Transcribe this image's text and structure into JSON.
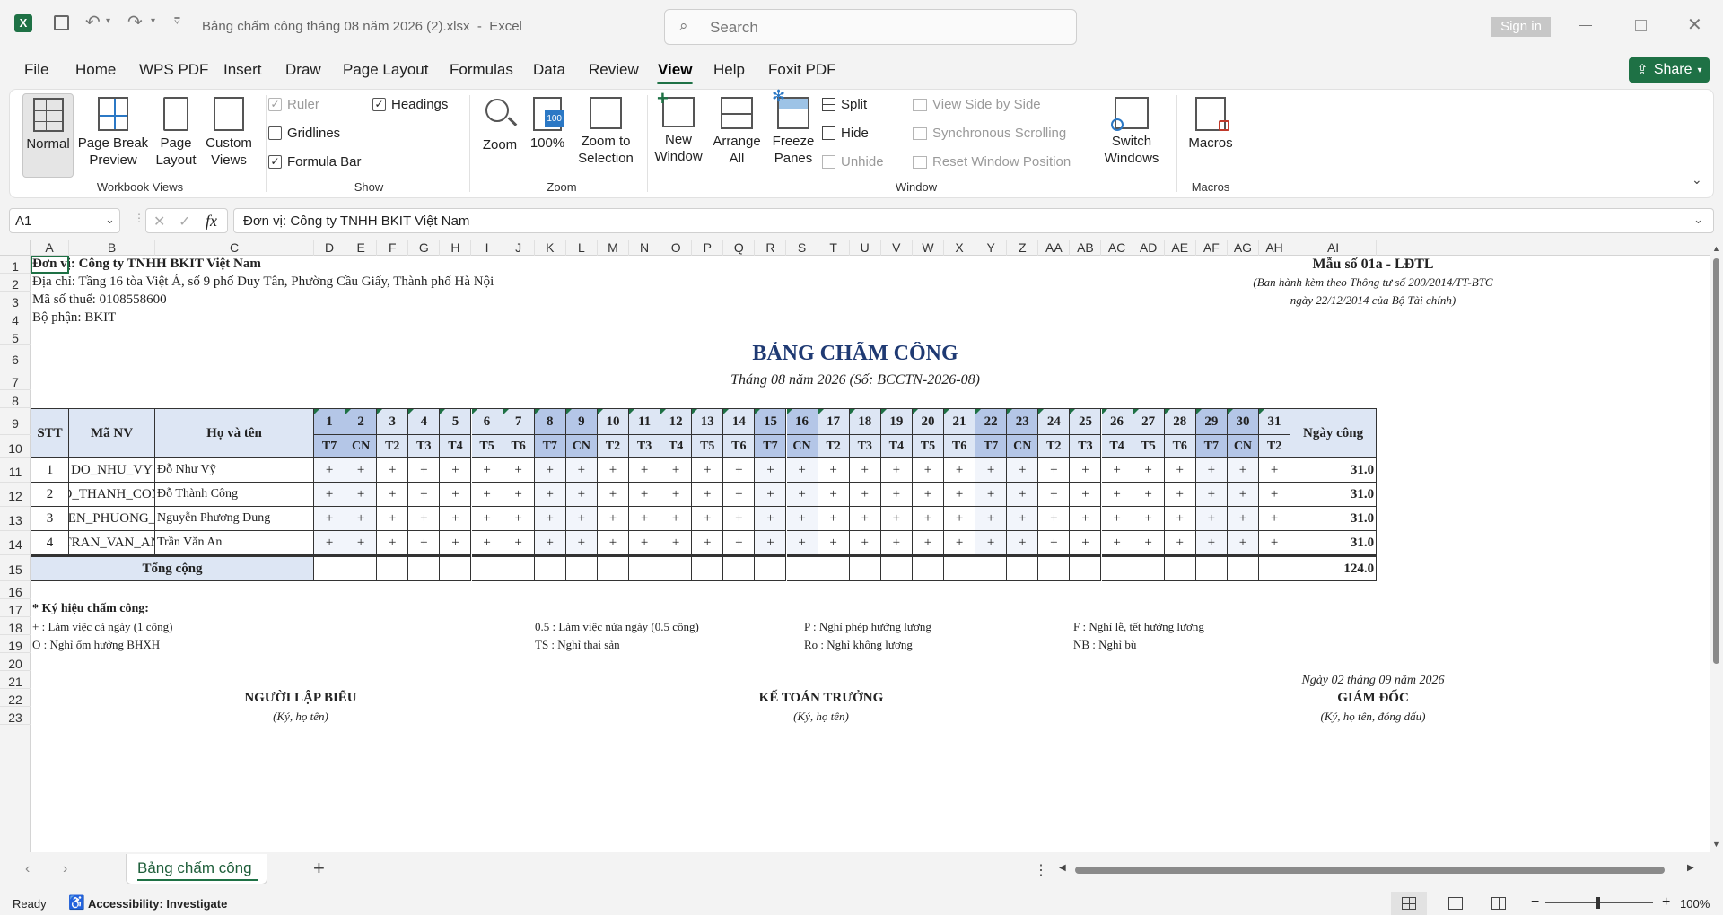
{
  "titlebar": {
    "filename": "Bảng chấm công tháng 08 năm 2026 (2).xlsx",
    "app": "Excel",
    "search_placeholder": "Search",
    "signin": "Sign in"
  },
  "menu": [
    "File",
    "Home",
    "WPS PDF",
    "Insert",
    "Draw",
    "Page Layout",
    "Formulas",
    "Data",
    "Review",
    "View",
    "Help",
    "Foxit PDF"
  ],
  "share": "Share",
  "ribbon": {
    "workbook_views": {
      "label": "Workbook Views",
      "normal": "Normal",
      "page_break": "Page Break Preview",
      "page_layout": "Page Layout",
      "custom": "Custom Views"
    },
    "show": {
      "label": "Show",
      "ruler": "Ruler",
      "gridlines": "Gridlines",
      "formula_bar": "Formula Bar",
      "headings": "Headings"
    },
    "zoom": {
      "label": "Zoom",
      "zoom": "Zoom",
      "hundred": "100%",
      "zoom_sel": "Zoom to Selection"
    },
    "window": {
      "label": "Window",
      "new_window": "New Window",
      "arrange": "Arrange All",
      "freeze": "Freeze Panes",
      "split": "Split",
      "hide": "Hide",
      "unhide": "Unhide",
      "side": "View Side by Side",
      "sync": "Synchronous Scrolling",
      "reset": "Reset Window Position",
      "switch": "Switch Windows"
    },
    "macros": {
      "label": "Macros",
      "macros": "Macros"
    }
  },
  "formula": {
    "namebox": "A1",
    "fx": "fx",
    "value": "Đơn vị: Công ty TNHH BKIT Việt Nam"
  },
  "columns": [
    "A",
    "B",
    "C",
    "D",
    "E",
    "F",
    "G",
    "H",
    "I",
    "J",
    "K",
    "L",
    "M",
    "N",
    "O",
    "P",
    "Q",
    "R",
    "S",
    "T",
    "U",
    "V",
    "W",
    "X",
    "Y",
    "Z",
    "AA",
    "AB",
    "AC",
    "AD",
    "AE",
    "AF",
    "AG",
    "AH",
    "AI"
  ],
  "rows": [
    "1",
    "2",
    "3",
    "4",
    "5",
    "6",
    "7",
    "8",
    "9",
    "10",
    "11",
    "12",
    "13",
    "14",
    "15",
    "16",
    "17",
    "18",
    "19",
    "20",
    "21",
    "22",
    "23"
  ],
  "doc": {
    "unit": "Đơn vị: Công ty TNHH BKIT Việt Nam",
    "address": "Địa chỉ: Tầng 16 tòa Việt Á, số 9 phố Duy Tân, Phường Cầu Giấy, Thành phố Hà Nội",
    "tax": "Mã số thuế: 0108558600",
    "dept": "Bộ phận: BKIT",
    "form": "Mẫu số 01a - LĐTL",
    "form_note1": "(Ban hành kèm theo Thông tư số 200/2014/TT-BTC",
    "form_note2": "ngày 22/12/2014 của Bộ Tài chính)",
    "title": "BẢNG CHẤM CÔNG",
    "subtitle": "Tháng 08 năm 2026 (Số: BCCTN-2026-08)"
  },
  "table": {
    "h_stt": "STT",
    "h_ma": "Mã NV",
    "h_ten": "Họ và tên",
    "h_ngay": "Ngày công",
    "days": [
      "1",
      "2",
      "3",
      "4",
      "5",
      "6",
      "7",
      "8",
      "9",
      "10",
      "11",
      "12",
      "13",
      "14",
      "15",
      "16",
      "17",
      "18",
      "19",
      "20",
      "21",
      "22",
      "23",
      "24",
      "25",
      "26",
      "27",
      "28",
      "29",
      "30",
      "31"
    ],
    "weekdays": [
      "T7",
      "CN",
      "T2",
      "T3",
      "T4",
      "T5",
      "T6",
      "T7",
      "CN",
      "T2",
      "T3",
      "T4",
      "T5",
      "T6",
      "T7",
      "CN",
      "T2",
      "T3",
      "T4",
      "T5",
      "T6",
      "T7",
      "CN",
      "T2",
      "T3",
      "T4",
      "T5",
      "T6",
      "T7",
      "CN",
      "T2"
    ],
    "weekend_days": [
      1,
      2,
      8,
      9,
      15,
      16,
      22,
      23,
      29,
      30
    ],
    "employees": [
      {
        "stt": "1",
        "ma": "DO_NHU_VY",
        "ten": "Đỗ Như Vỹ",
        "mark": "+",
        "total": "31.0"
      },
      {
        "stt": "2",
        "ma": "DO_THANH_CONG",
        "ten": "Đỗ Thành Công",
        "mark": "+",
        "total": "31.0"
      },
      {
        "stt": "3",
        "ma": "NGUYEN_PHUONG_DUNG",
        "ten": "Nguyễn Phương Dung",
        "mark": "+",
        "total": "31.0"
      },
      {
        "stt": "4",
        "ma": "TRAN_VAN_AN",
        "ten": "Trần Văn An",
        "mark": "+",
        "total": "31.0"
      }
    ],
    "total_label": "Tổng cộng",
    "total_value": "124.0"
  },
  "legend": {
    "title": "* Ký hiệu chấm công:",
    "items": [
      "+ : Làm việc cả ngày (1 công)",
      "0.5 : Làm việc nửa ngày (0.5 công)",
      "P : Nghỉ phép hưởng lương",
      "F : Nghỉ lễ, tết hưởng lương",
      "O : Nghỉ ốm hưởng BHXH",
      "TS : Nghỉ thai sản",
      "Ro : Nghỉ không lương",
      "NB : Nghỉ bù"
    ]
  },
  "sign": {
    "date": "Ngày 02 tháng 09 năm 2026",
    "p1": "NGƯỜI LẬP BIỂU",
    "p1n": "(Ký, họ tên)",
    "p2": "KẾ TOÁN TRƯỞNG",
    "p2n": "(Ký, họ tên)",
    "p3": "GIÁM ĐỐC",
    "p3n": "(Ký, họ tên, đóng dấu)"
  },
  "sheet_tab": "Bảng chấm công",
  "status": {
    "ready": "Ready",
    "accessibility": "Accessibility: Investigate",
    "zoom": "100%"
  }
}
